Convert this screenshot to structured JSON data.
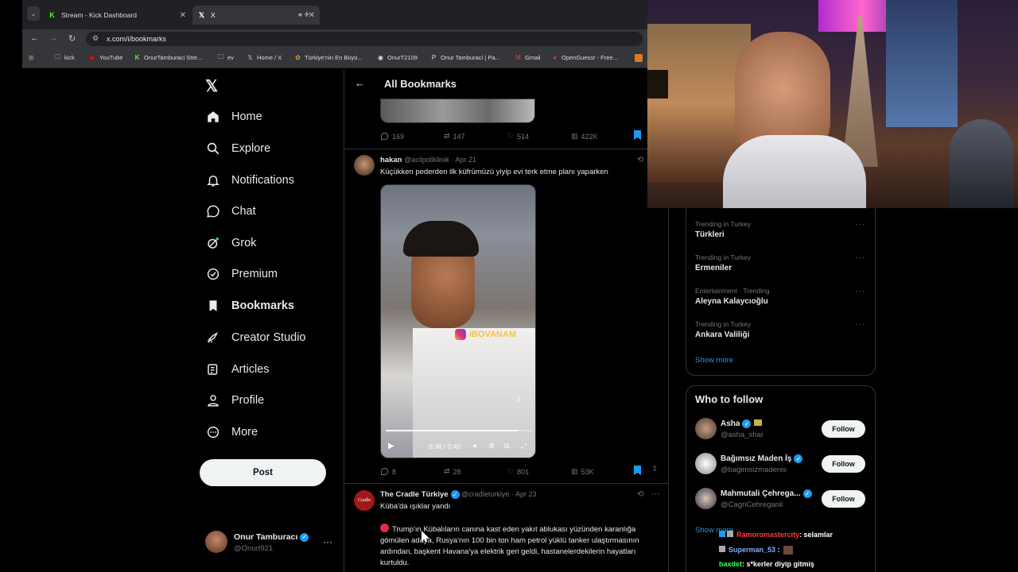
{
  "browser": {
    "tabs": [
      {
        "label": "Stream - Kick Dashboard"
      },
      {
        "label": "X"
      }
    ],
    "url": "x.com/i/bookmarks",
    "bookmarks": [
      "kick",
      "YouTube",
      "OnurTamburaci Stre...",
      "ev",
      "Home / X",
      "Türkiye'nin En Büyü...",
      "OnurT2109",
      "Onur Tamburaci | Pa...",
      "Gmail",
      "OpenGuessr - Free..."
    ]
  },
  "sidebar": {
    "items": [
      {
        "label": "Home",
        "icon": "home-icon"
      },
      {
        "label": "Explore",
        "icon": "search-icon"
      },
      {
        "label": "Notifications",
        "icon": "bell-icon"
      },
      {
        "label": "Chat",
        "icon": "chat-icon"
      },
      {
        "label": "Grok",
        "icon": "grok-icon"
      },
      {
        "label": "Premium",
        "icon": "premium-icon"
      },
      {
        "label": "Bookmarks",
        "icon": "bookmark-icon"
      },
      {
        "label": "Creator Studio",
        "icon": "rocket-icon"
      },
      {
        "label": "Articles",
        "icon": "articles-icon"
      },
      {
        "label": "Profile",
        "icon": "person-icon"
      },
      {
        "label": "More",
        "icon": "more-icon"
      }
    ],
    "post_label": "Post",
    "account": {
      "name": "Onur Tamburacı",
      "handle": "@Onurt921"
    }
  },
  "header": {
    "title": "All Bookmarks"
  },
  "tweets": [
    {
      "stats": {
        "replies": "169",
        "reposts": "147",
        "likes": "514",
        "views": "422K"
      }
    },
    {
      "name": "hakan",
      "handle": "@acilpoliklinik",
      "date": "· Apr 21",
      "text": "Küçükken pederden ilk küfrümüzü yiyip evi terk etme planı yaparken",
      "video": {
        "time": "0:36 / 0:40",
        "watermark": "iBOVANAM",
        "progress": 0.9
      },
      "stats": {
        "replies": "8",
        "reposts": "28",
        "likes": "801",
        "views": "53K"
      }
    },
    {
      "name": "The Cradle Türkiye",
      "handle": "@cradleturkiye",
      "date": "· Apr 23",
      "line1": "Küba'da ışıklar yandı",
      "body": "Trump'ın Kübalıların canına kast eden yakıt ablukası yüzünden karanlığa gömülen adaya, Rusya'nın 100 bin ton ham petrol yüklü tanker ulaştırmasının ardından, başkent Havana'ya elektrik geri geldi, hastanelerdekilerin hayatları kurtuldu."
    }
  ],
  "trends": [
    {
      "category": "Trending in Turkey",
      "name": "Türkleri"
    },
    {
      "category": "Trending in Turkey",
      "name": "Ermeniler"
    },
    {
      "category": "Entertainment · Trending",
      "name": "Aleyna Kalaycıoğlu"
    },
    {
      "category": "Trending in Turkey",
      "name": "Ankara Valiliği"
    }
  ],
  "show_more": "Show more",
  "who_to_follow": {
    "title": "Who to follow",
    "follow_label": "Follow",
    "users": [
      {
        "name": "Asha",
        "handle": "@asha_shar"
      },
      {
        "name": "Bağımsız Maden İş",
        "handle": "@bagimsizmadenis"
      },
      {
        "name": "Mahmutali Çehrega...",
        "handle": "@CagriCehreganli"
      }
    ],
    "show_more": "Show more"
  },
  "chat_overlay": [
    {
      "user": "Ramoromastercity",
      "msg": ": selamlar",
      "color": "#ff3b3b"
    },
    {
      "user": "Superman_53",
      "msg": " :",
      "color": "#7fb0ff"
    },
    {
      "user": "baxdet",
      "msg": ": s*kerler diyip gitmiş",
      "color": "#41ff5a"
    }
  ],
  "colors": {
    "accent": "#1d9bf0",
    "kick_green": "#53fc18"
  }
}
